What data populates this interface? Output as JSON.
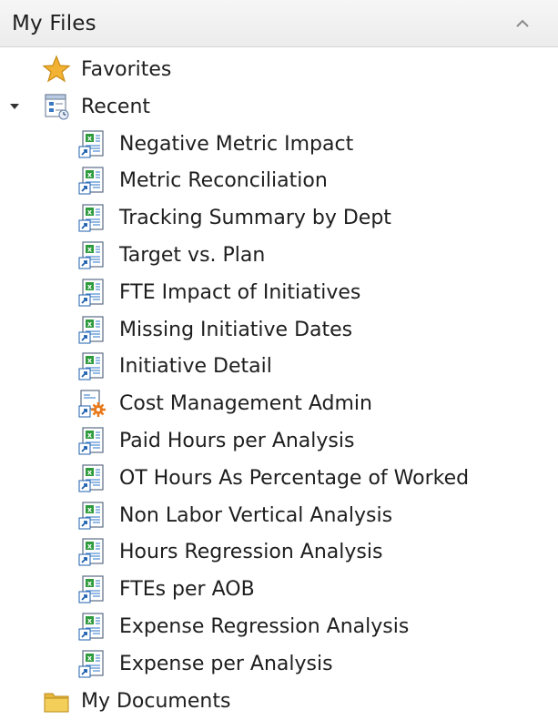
{
  "header": {
    "title": "My Files",
    "collapse_icon": "chevron-up-icon"
  },
  "tree": {
    "favorites": {
      "label": "Favorites",
      "icon": "star-icon"
    },
    "recent": {
      "label": "Recent",
      "icon": "recent-documents-icon",
      "expanded": true,
      "items": [
        {
          "label": "Negative Metric Impact",
          "icon": "report-shortcut-icon"
        },
        {
          "label": "Metric Reconciliation",
          "icon": "report-shortcut-icon"
        },
        {
          "label": "Tracking Summary by Dept",
          "icon": "report-shortcut-icon"
        },
        {
          "label": "Target vs. Plan",
          "icon": "report-shortcut-icon"
        },
        {
          "label": "FTE Impact of Initiatives",
          "icon": "report-shortcut-icon"
        },
        {
          "label": "Missing Initiative Dates",
          "icon": "report-shortcut-icon"
        },
        {
          "label": "Initiative Detail",
          "icon": "report-shortcut-icon"
        },
        {
          "label": "Cost Management Admin",
          "icon": "admin-shortcut-icon"
        },
        {
          "label": "Paid Hours per Analysis",
          "icon": "report-shortcut-icon"
        },
        {
          "label": "OT Hours As Percentage of Worked",
          "icon": "report-shortcut-icon"
        },
        {
          "label": "Non Labor Vertical Analysis",
          "icon": "report-shortcut-icon"
        },
        {
          "label": "Hours Regression Analysis",
          "icon": "report-shortcut-icon"
        },
        {
          "label": "FTEs per AOB",
          "icon": "report-shortcut-icon"
        },
        {
          "label": "Expense Regression Analysis",
          "icon": "report-shortcut-icon"
        },
        {
          "label": "Expense per Analysis",
          "icon": "report-shortcut-icon"
        }
      ]
    },
    "my_documents": {
      "label": "My Documents",
      "icon": "folder-icon"
    }
  },
  "colors": {
    "header_bg": "#ececec",
    "star": "#f2b233",
    "folder": "#e8b83c",
    "report_green": "#2e9b3c",
    "shortcut_blue": "#1c5fae",
    "admin_orange": "#e8791a"
  }
}
